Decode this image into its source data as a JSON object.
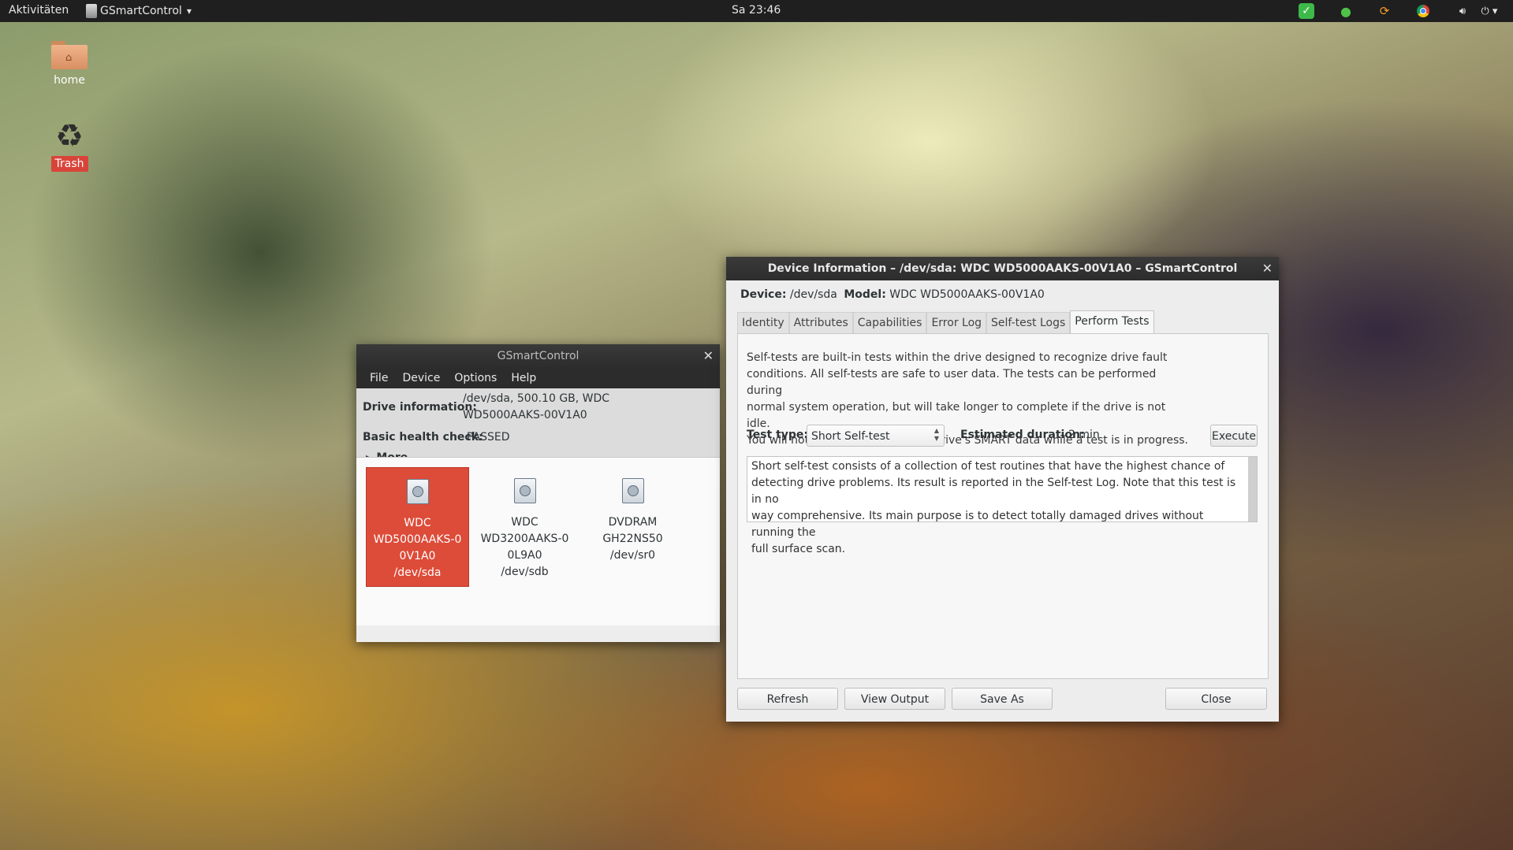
{
  "topbar": {
    "activities": "Aktivitäten",
    "app_menu": "GSmartControl",
    "app_menu_arrow": "▾",
    "clock": "Sa 23:46",
    "tray_icons": [
      "check-icon",
      "leaf-icon",
      "update-icon",
      "chrome-icon",
      "volume-icon",
      "power-icon"
    ]
  },
  "desktop": {
    "home_label": "home",
    "trash_label": "Trash"
  },
  "main_window": {
    "title": "GSmartControl",
    "menu": [
      "File",
      "Device",
      "Options",
      "Help"
    ],
    "drive_info_label": "Drive information:",
    "drive_info_line1": "/dev/sda, 500.10 GB, WDC",
    "drive_info_line2": "WD5000AAKS-00V1A0",
    "health_label": "Basic health check:",
    "health_value": "PASSED",
    "more_label": "More",
    "drives": [
      {
        "lines": [
          "WDC",
          "WD5000AAKS-0",
          "0V1A0",
          "/dev/sda"
        ],
        "selected": true
      },
      {
        "lines": [
          "WDC",
          "WD3200AAKS-0",
          "0L9A0",
          "/dev/sdb"
        ],
        "selected": false
      },
      {
        "lines": [
          "DVDRAM",
          "GH22NS50",
          "/dev/sr0"
        ],
        "selected": false
      }
    ]
  },
  "device_window": {
    "title": "Device Information – /dev/sda: WDC WD5000AAKS-00V1A0 – GSmartControl",
    "device_label": "Device:",
    "device_value": "/dev/sda",
    "model_label": "Model:",
    "model_value": "WDC WD5000AAKS-00V1A0",
    "tabs": [
      "Identity",
      "Attributes",
      "Capabilities",
      "Error Log",
      "Self-test Logs",
      "Perform Tests"
    ],
    "active_tab": "Perform Tests",
    "description_lines": [
      "Self-tests are built-in tests within the drive designed to recognize drive fault",
      "conditions. All self-tests are safe to user data. The tests can be performed during",
      "normal system operation, but will take longer to complete if the drive is not idle.",
      "You will not be able to access the drive's SMART data while a test is in progress."
    ],
    "test_type_label": "Test type:",
    "test_type_value": "Short Self-test",
    "duration_label": "Estimated duration:",
    "duration_value": "2 min",
    "execute_label": "Execute",
    "test_description_lines": [
      "Short self-test consists of a collection of test routines that have the highest chance of",
      "detecting drive problems. Its result is reported in the Self-test Log. Note that this test is in no",
      "way comprehensive. Its main purpose is to detect totally damaged drives without running the",
      "full surface scan."
    ],
    "buttons": {
      "refresh": "Refresh",
      "view_output": "View Output",
      "save_as": "Save As",
      "close": "Close"
    }
  }
}
